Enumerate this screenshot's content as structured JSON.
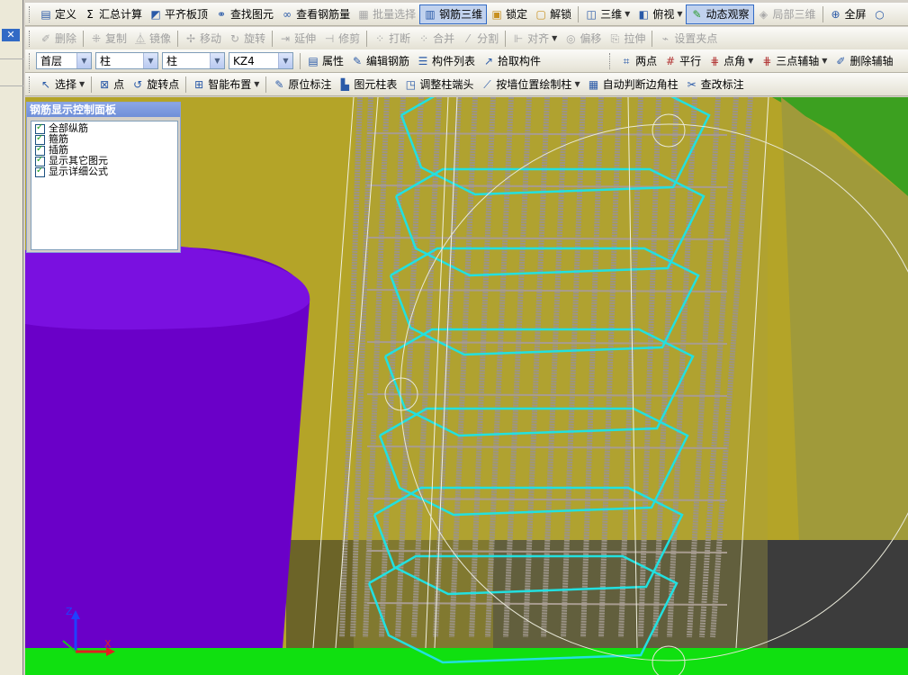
{
  "toolbar1": {
    "items": [
      {
        "label": "定义",
        "icon": "define-icon"
      },
      {
        "label": "汇总计算",
        "icon": "sigma-icon"
      },
      {
        "label": "平齐板顶",
        "icon": "align-slab-icon"
      },
      {
        "label": "查找图元",
        "icon": "binoculars-icon"
      },
      {
        "label": "查看钢筋量",
        "icon": "glasses-icon"
      },
      {
        "label": "批量选择",
        "icon": "batch-select-icon"
      },
      {
        "label": "钢筋三维",
        "icon": "rebar-3d-icon"
      },
      {
        "label": "锁定",
        "icon": "lock-icon"
      },
      {
        "label": "解锁",
        "icon": "unlock-icon"
      },
      {
        "label": "三维",
        "icon": "cube-icon"
      },
      {
        "label": "俯视",
        "icon": "top-view-icon"
      },
      {
        "label": "动态观察",
        "icon": "orbit-icon"
      },
      {
        "label": "局部三维",
        "icon": "local-3d-icon"
      },
      {
        "label": "全屏",
        "icon": "zoom-icon"
      }
    ]
  },
  "toolbar2": {
    "items": [
      {
        "label": "删除",
        "icon": "delete-icon"
      },
      {
        "label": "复制",
        "icon": "copy-icon"
      },
      {
        "label": "镜像",
        "icon": "mirror-icon"
      },
      {
        "label": "移动",
        "icon": "move-icon"
      },
      {
        "label": "旋转",
        "icon": "rotate-icon"
      },
      {
        "label": "延伸",
        "icon": "extend-icon"
      },
      {
        "label": "修剪",
        "icon": "trim-icon"
      },
      {
        "label": "打断",
        "icon": "break-icon"
      },
      {
        "label": "合并",
        "icon": "merge-icon"
      },
      {
        "label": "分割",
        "icon": "split-icon"
      },
      {
        "label": "对齐",
        "icon": "align-icon"
      },
      {
        "label": "偏移",
        "icon": "offset-icon"
      },
      {
        "label": "拉伸",
        "icon": "stretch-icon"
      },
      {
        "label": "设置夹点",
        "icon": "grip-point-icon"
      }
    ]
  },
  "toolbar3": {
    "floor": "首层",
    "category": "柱",
    "type": "柱",
    "component": "KZ4",
    "items": [
      {
        "label": "属性",
        "icon": "properties-icon"
      },
      {
        "label": "编辑钢筋",
        "icon": "edit-rebar-icon"
      },
      {
        "label": "构件列表",
        "icon": "list-icon"
      },
      {
        "label": "拾取构件",
        "icon": "pick-icon"
      }
    ],
    "axis_items": [
      {
        "label": "两点",
        "icon": "two-point-icon"
      },
      {
        "label": "平行",
        "icon": "parallel-icon"
      },
      {
        "label": "点角",
        "icon": "point-angle-icon"
      },
      {
        "label": "三点辅轴",
        "icon": "three-point-axis-icon"
      },
      {
        "label": "删除辅轴",
        "icon": "delete-axis-icon"
      }
    ]
  },
  "toolbar4": {
    "items": [
      {
        "label": "选择",
        "icon": "cursor-icon"
      },
      {
        "label": "点",
        "icon": "point-icon"
      },
      {
        "label": "旋转点",
        "icon": "rotate-point-icon"
      },
      {
        "label": "智能布置",
        "icon": "smart-layout-icon"
      },
      {
        "label": "原位标注",
        "icon": "annotate-icon"
      },
      {
        "label": "图元柱表",
        "icon": "column-table-icon"
      },
      {
        "label": "调整柱端头",
        "icon": "adjust-end-icon"
      },
      {
        "label": "按墙位置绘制柱",
        "icon": "wall-column-icon"
      },
      {
        "label": "自动判断边角柱",
        "icon": "auto-corner-icon"
      },
      {
        "label": "查改标注",
        "icon": "check-annotation-icon"
      }
    ]
  },
  "panel": {
    "title": "钢筋显示控制面板",
    "options": [
      "全部纵筋",
      "箍筋",
      "插筋",
      "显示其它图元",
      "显示详细公式"
    ]
  },
  "colors": {
    "viewport_bg": "#b4a428",
    "column_purple": "#6a00c8",
    "stirrup_cyan": "#22e0e0",
    "rebar_gray": "#9c9488",
    "ground_green": "#10e010",
    "dark_wall": "#3c3c3c"
  },
  "axis_labels": {
    "z": "Z",
    "x": "X"
  }
}
